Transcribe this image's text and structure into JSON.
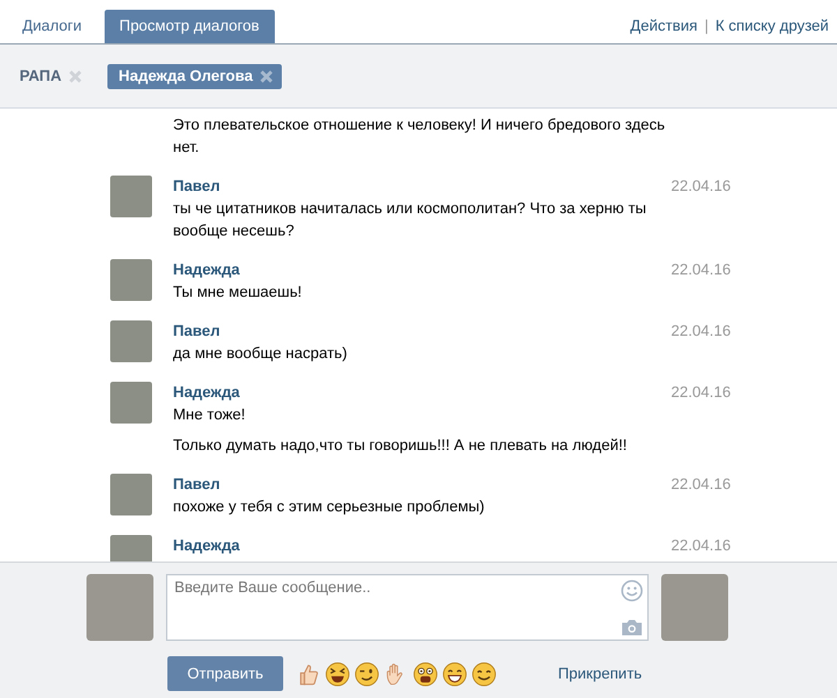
{
  "tabs": [
    {
      "label": "Диалоги",
      "selected": false
    },
    {
      "label": "Просмотр диалогов",
      "selected": true
    }
  ],
  "header_links": {
    "items": [
      "Действия",
      "К списку друзей"
    ],
    "separator": "|"
  },
  "peers": [
    {
      "name": "РАПА",
      "selected": false
    },
    {
      "name": "Надежда Олегова",
      "selected": true
    }
  ],
  "messages": [
    {
      "texts": [
        "Это плевательское отношение к человеку! И ничего бредового здесь нет."
      ]
    },
    {
      "author": "Павел",
      "date": "22.04.16",
      "texts": [
        "ты че цитатников начиталась или космополитан? Что за херню ты вообще несешь?"
      ]
    },
    {
      "author": "Надежда",
      "date": "22.04.16",
      "texts": [
        "Ты мне мешаешь!"
      ]
    },
    {
      "author": "Павел",
      "date": "22.04.16",
      "texts": [
        "да мне вообще насрать)"
      ]
    },
    {
      "author": "Надежда",
      "date": "22.04.16",
      "texts": [
        "Мне тоже!",
        "Только думать надо,что ты говоришь!!! А не плевать на людей!!"
      ]
    },
    {
      "author": "Павел",
      "date": "22.04.16",
      "texts": [
        "похоже у тебя с этим серьезные проблемы)"
      ]
    },
    {
      "author": "Надежда",
      "date": "22.04.16"
    }
  ],
  "compose": {
    "placeholder": "Введите Ваше сообщение..",
    "send_button": "Отправить",
    "attach_link": "Прикрепить",
    "emojis": [
      {
        "kind": "thumbs"
      },
      {
        "kind": "laugh"
      },
      {
        "kind": "wink"
      },
      {
        "kind": "hand"
      },
      {
        "kind": "shock"
      },
      {
        "kind": "grin"
      },
      {
        "kind": "smile"
      }
    ]
  }
}
